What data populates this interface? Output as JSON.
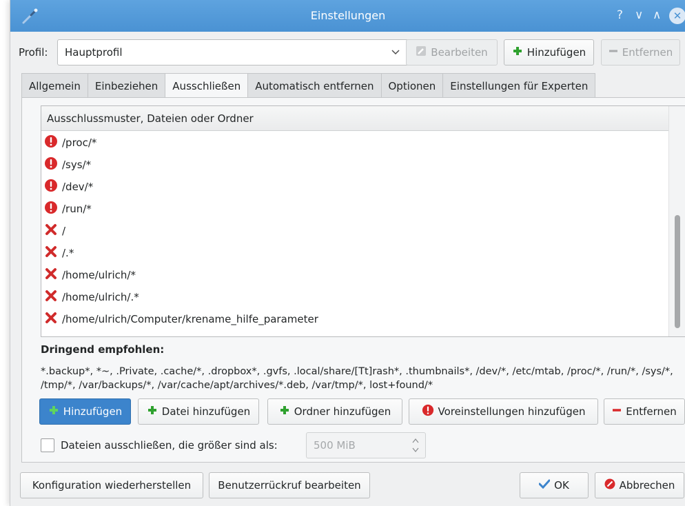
{
  "window": {
    "title": "Einstellungen",
    "help_glyph": "?",
    "minimize_glyph": "∨",
    "maximize_glyph": "∧",
    "close_glyph": "✕"
  },
  "profile": {
    "label": "Profil:",
    "selected": "Hauptprofil",
    "edit_label": "Bearbeiten",
    "add_label": "Hinzufügen",
    "remove_label": "Entfernen"
  },
  "tabs": [
    "Allgemein",
    "Einbeziehen",
    "Ausschließen",
    "Automatisch entfernen",
    "Optionen",
    "Einstellungen für Experten"
  ],
  "active_tab": "Ausschließen",
  "exclude_list": {
    "header": "Ausschlussmuster, Dateien oder Ordner",
    "rows": [
      {
        "text": "/proc/*",
        "icon": "warning-icon"
      },
      {
        "text": "/sys/*",
        "icon": "warning-icon"
      },
      {
        "text": "/dev/*",
        "icon": "warning-icon"
      },
      {
        "text": "/run/*",
        "icon": "warning-icon"
      },
      {
        "text": "/",
        "icon": "x-icon"
      },
      {
        "text": "/.*",
        "icon": "x-icon"
      },
      {
        "text": "/home/ulrich/*",
        "icon": "x-icon"
      },
      {
        "text": "/home/ulrich/.*",
        "icon": "x-icon"
      },
      {
        "text": "/home/ulrich/Computer/krename_hilfe_parameter",
        "icon": "x-icon"
      }
    ]
  },
  "recommended": {
    "title": "Dringend empfohlen:",
    "text": "*.backup*, *~, .Private, .cache/*, .dropbox*, .gvfs, .local/share/[Tt]rash*, .thumbnails*, /dev/*, /etc/mtab, /proc/*, /run/*, /sys/*, /tmp/*, /var/backups/*, /var/cache/apt/archives/*.deb, /var/tmp/*, lost+found/*"
  },
  "actions": {
    "add": "Hinzufügen",
    "add_file": "Datei hinzufügen",
    "add_folder": "Ordner hinzufügen",
    "add_defaults": "Voreinstellungen hinzufügen",
    "remove": "Entfernen"
  },
  "size_filter": {
    "label": "Dateien ausschließen, die größer sind als:",
    "value": "500 MiB",
    "checked": false
  },
  "footer": {
    "restore": "Konfiguration wiederherstellen",
    "edit_callback": "Benutzerrückruf bearbeiten",
    "ok": "OK",
    "cancel": "Abbrechen"
  },
  "colors": {
    "titlebar": "#4a92d3",
    "accent_button": "#3c84cc",
    "warning": "#d9292b",
    "plus_green": "#2fa12f"
  }
}
